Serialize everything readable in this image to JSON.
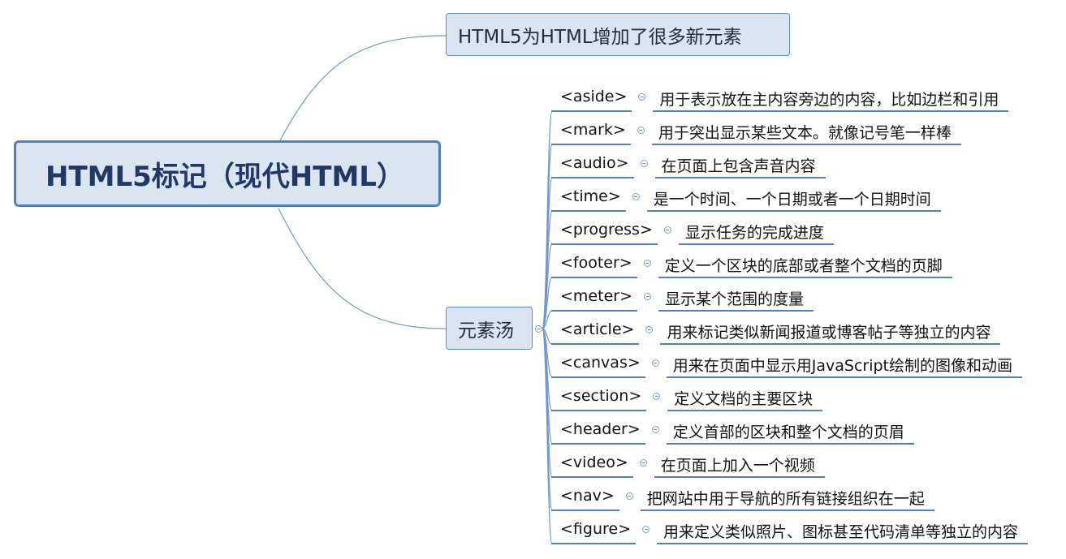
{
  "root": {
    "label": "HTML5标记（现代HTML）"
  },
  "topic1": {
    "label": "HTML5为HTML增加了很多新元素"
  },
  "topic2": {
    "label": "元素汤"
  },
  "elements": [
    {
      "tag": "<aside>",
      "description": "用于表示放在主内容旁边的内容，比如边栏和引用"
    },
    {
      "tag": "<mark>",
      "description": "用于突出显示某些文本。就像记号笔一样棒"
    },
    {
      "tag": "<audio>",
      "description": "在页面上包含声音内容"
    },
    {
      "tag": "<time>",
      "description": "是一个时间、一个日期或者一个日期时间"
    },
    {
      "tag": "<progress>",
      "description": "显示任务的完成进度"
    },
    {
      "tag": "<footer>",
      "description": "定义一个区块的底部或者整个文档的页脚"
    },
    {
      "tag": "<meter>",
      "description": "显示某个范围的度量"
    },
    {
      "tag": "<article>",
      "description": "用来标记类似新闻报道或博客帖子等独立的内容"
    },
    {
      "tag": "<canvas>",
      "description": "用来在页面中显示用JavaScript绘制的图像和动画"
    },
    {
      "tag": "<section>",
      "description": "定义文档的主要区块"
    },
    {
      "tag": "<header>",
      "description": "定义首部的区块和整个文档的页眉"
    },
    {
      "tag": "<video>",
      "description": "在页面上加入一个视频"
    },
    {
      "tag": "<nav>",
      "description": "把网站中用于导航的所有链接组织在一起"
    },
    {
      "tag": "<figure>",
      "description": "用来定义类似照片、图标甚至代码清单等独立的内容"
    }
  ],
  "colors": {
    "line": "#4f81bd",
    "node_fill": "#dbe5f1",
    "text": "#1f3864"
  }
}
